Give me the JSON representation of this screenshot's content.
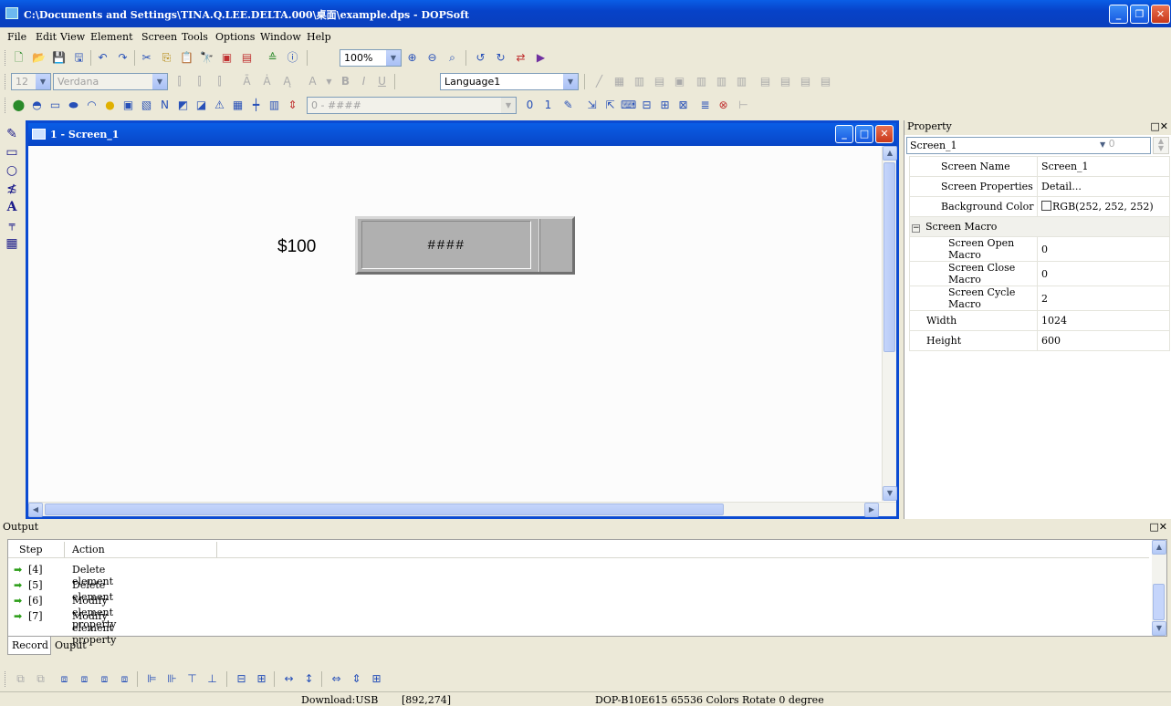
{
  "window": {
    "title": "C:\\Documents and Settings\\TINA.Q.LEE.DELTA.000\\桌面\\example.dps - DOPSoft",
    "min_glyph": "_",
    "restore_glyph": "❐",
    "close_glyph": "✕"
  },
  "menu": {
    "items": [
      "File",
      "Edit",
      "View",
      "Element",
      "Screen",
      "Tools",
      "Options",
      "Window",
      "Help"
    ]
  },
  "toolbar1": {
    "zoom_value": "100%"
  },
  "toolbar2": {
    "font_size": "12",
    "font_name": "Verdana",
    "language": "Language1"
  },
  "toolbar3": {
    "format_value": "0 - ####"
  },
  "screen_window": {
    "title": "1 - Screen_1",
    "price_label": "$100",
    "input_display": "####"
  },
  "property": {
    "header": "Property",
    "header_buttons": "□✕",
    "selected": "Screen_1",
    "spin_value": "0",
    "rows": [
      {
        "key": "Screen Name",
        "value": "Screen_1"
      },
      {
        "key": "Screen Properties",
        "value": "Detail..."
      },
      {
        "key": "Background Color",
        "value": "RGB(252, 252, 252)"
      }
    ],
    "group": "Screen Macro",
    "macro_rows": [
      {
        "key": "Screen Open Macro",
        "value": "0"
      },
      {
        "key": "Screen Close Macro",
        "value": "0"
      },
      {
        "key": "Screen Cycle Macro",
        "value": "2"
      }
    ],
    "size_rows": [
      {
        "key": "Width",
        "value": "1024"
      },
      {
        "key": "Height",
        "value": "600"
      }
    ]
  },
  "output": {
    "header": "Output",
    "header_buttons": "□✕",
    "col_step": "Step",
    "col_action": "Action",
    "rows": [
      {
        "step": "[4]",
        "action": "Delete element"
      },
      {
        "step": "[5]",
        "action": "Delete element"
      },
      {
        "step": "[6]",
        "action": "Modify element property"
      },
      {
        "step": "[7]",
        "action": "Modify element property"
      }
    ],
    "tabs": [
      "Record",
      "Ouput"
    ]
  },
  "status": {
    "download": "Download:USB",
    "coords": "[892,274]",
    "device": "DOP-B10E615 65536 Colors Rotate 0 degree"
  },
  "colors": {
    "titlebar": "#0a5ee6",
    "button_face": "#b0b0b0",
    "arrow_green": "#2a9d16"
  }
}
